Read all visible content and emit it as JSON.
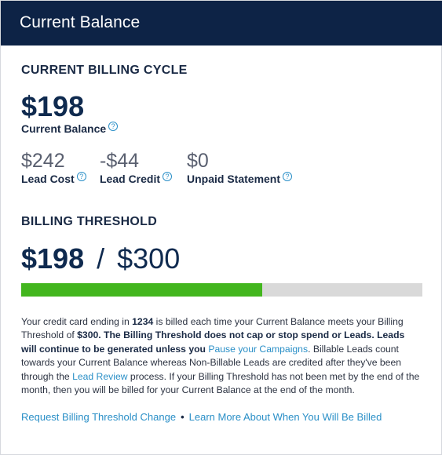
{
  "header": {
    "title": "Current Balance"
  },
  "billing_cycle": {
    "section_title": "CURRENT BILLING CYCLE",
    "current_balance": "$198",
    "current_balance_label": "Current Balance",
    "stats": [
      {
        "value": "$242",
        "label": "Lead Cost"
      },
      {
        "value": "-$44",
        "label": "Lead Credit"
      },
      {
        "value": "$0",
        "label": "Unpaid Statement"
      }
    ]
  },
  "threshold": {
    "section_title": "BILLING THRESHOLD",
    "current": "$198",
    "separator": "/",
    "max": "$300",
    "progress_fraction": 0.6,
    "fill_color": "#43b61e",
    "track_color": "#d9d9d9"
  },
  "description": {
    "p1": "Your credit card ending in ",
    "card_last4": "1234",
    "p2": " is billed each time your Current Balance meets your Billing Threshold of ",
    "threshold_amount": "$300",
    "p3": ". The Billing Threshold does not cap or stop spend or Leads. Leads will continue to be generated unless you ",
    "pause_link": "Pause your Campaigns",
    "p4": ". Billable Leads count towards your Current Balance whereas Non-Billable Leads are credited after they've been through the ",
    "lead_review_link": "Lead Review",
    "p5": " process. If your Billing Threshold has not been met by the end of the month, then you will be billed for your Current Balance at the end of the month."
  },
  "links": {
    "request_change": "Request Billing Threshold Change",
    "separator": "•",
    "learn_more": "Learn More About When You Will Be Billed"
  },
  "icons": {
    "help": "help-circle-icon"
  },
  "colors": {
    "header_bg": "#0d2346",
    "link": "#2a8fc7",
    "text_dark": "#0f2a4f"
  }
}
